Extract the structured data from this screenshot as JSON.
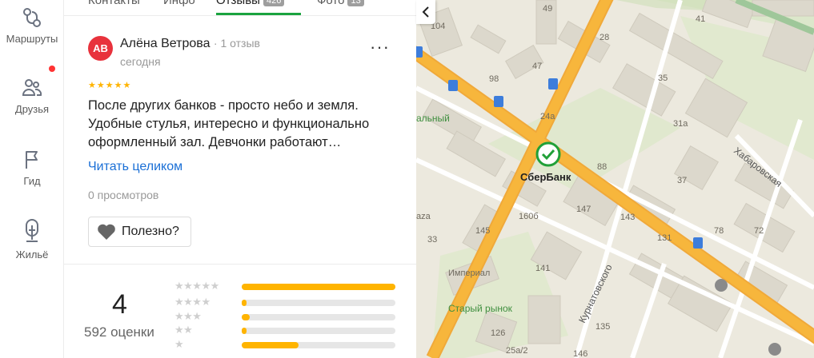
{
  "rail": {
    "routes_label": "Маршруты",
    "friends_label": "Друзья",
    "guide_label": "Гид",
    "housing_label": "Жильё"
  },
  "tabs": {
    "contacts": "Контакты",
    "info": "Инфо",
    "reviews": "Отзывы",
    "reviews_count": "426",
    "photo": "Фото",
    "photo_count": "13"
  },
  "review": {
    "avatar_initials": "АВ",
    "author": "Алёна Ветрова",
    "author_meta": "· 1 отзыв",
    "date": "сегодня",
    "stars": "★★★★★",
    "text": "После других банков - просто небо и земля. Удобные стулья, интересно и функционально оформленный зал. Девчонки работают…",
    "read_more": "Читать целиком",
    "views": "0 просмотров",
    "useful_label": "Полезно?"
  },
  "rating": {
    "value": "4",
    "count_label": "592 оценки",
    "distribution": [
      {
        "stars": "★★★★★",
        "fraction": 1.0
      },
      {
        "stars": "★★★★",
        "fraction": 0.03
      },
      {
        "stars": "★★★",
        "fraction": 0.05
      },
      {
        "stars": "★★",
        "fraction": 0.03
      },
      {
        "stars": "★",
        "fraction": 0.37
      }
    ]
  },
  "map": {
    "place_name": "СберБанк",
    "labels": {
      "n104": "104",
      "n49": "49",
      "n41": "41",
      "n28": "28",
      "n47": "47",
      "n98": "98",
      "n35": "35",
      "n24a": "24a",
      "n31a": "31a",
      "n88": "88",
      "n37": "37",
      "n147": "147",
      "n160b": "160б",
      "n143": "143",
      "n145": "145",
      "n131": "131",
      "n78": "78",
      "n72": "72",
      "n33": "33",
      "n141": "141",
      "n135": "135",
      "n126": "126",
      "n25a2": "25a/2",
      "n146": "146",
      "street_khab": "Хабаровская",
      "street_kurn": "Курнатовского",
      "imperial": "Империал",
      "old_market": "Старый рынок",
      "alny": "альный",
      "aza": "aza"
    }
  },
  "colors": {
    "accent_green": "#1aa33f",
    "star_yellow": "#ffb400",
    "link_blue": "#1a6fd6",
    "road_orange": "#f7b63c"
  }
}
